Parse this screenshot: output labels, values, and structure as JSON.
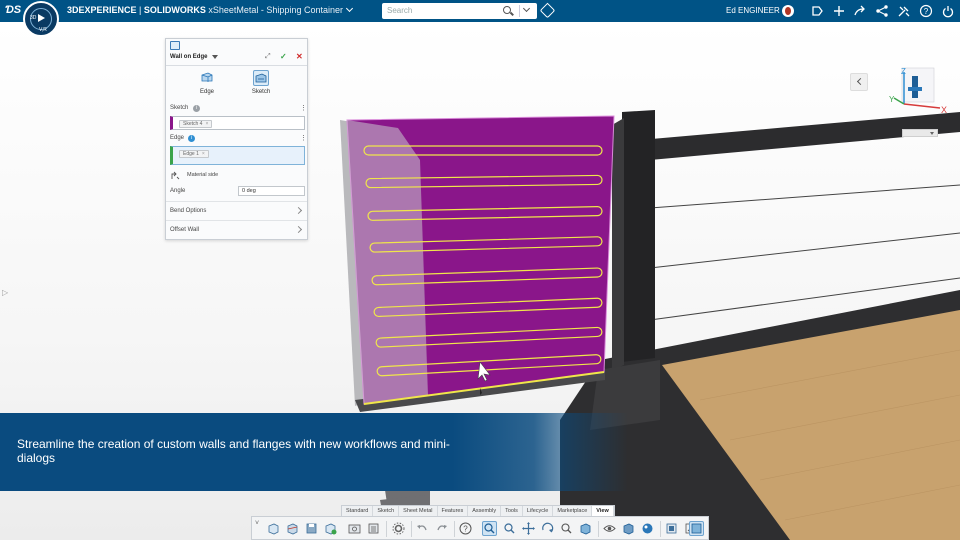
{
  "topbar": {
    "ds_logo": "ƊS",
    "compass_labels": {
      "top": "3D",
      "bottom": "V,R"
    },
    "brand_primary": "3DEXPERIENCE",
    "brand_separator": " | ",
    "brand_secondary": "SOLIDWORKS",
    "document_title": "xSheetMetal - Shipping Container",
    "search_placeholder": "Search",
    "user_name": "Ed ENGINEER",
    "icons": [
      "tag-icon",
      "avatar",
      "bookmark-icon",
      "plus-icon",
      "share-icon",
      "share-alt-icon",
      "tools-icon",
      "help-icon",
      "power-icon"
    ]
  },
  "property_manager": {
    "title": "Wall on Edge",
    "modes": [
      {
        "label": "Edge",
        "icon": "edge-mode-icon"
      },
      {
        "label": "Sketch",
        "icon": "sketch-mode-icon",
        "selected": true
      }
    ],
    "sketch_section": {
      "label": "Sketch",
      "chip": "Sketch 4"
    },
    "edge_section": {
      "label": "Edge",
      "chip": "Edge 1"
    },
    "material_side_label": "Material side",
    "angle": {
      "label": "Angle",
      "value": "0 deg"
    },
    "collapsed_sections": [
      "Bend Options",
      "Offset Wall"
    ]
  },
  "caption": {
    "text": "Streamline the creation of custom walls and flanges with new workflows and mini-dialogs"
  },
  "view_triad": {
    "axes": [
      "X",
      "Y",
      "Z"
    ]
  },
  "command_tabs": {
    "items": [
      "Standard",
      "Sketch",
      "Sheet Metal",
      "Features",
      "Assembly",
      "Tools",
      "Lifecycle",
      "Marketplace",
      "View"
    ],
    "active": "View"
  },
  "command_icons": [
    "view-orientation-icon",
    "section-view-icon",
    "save-icon",
    "rebuild-icon",
    "snapshot-icon",
    "appearance-icon",
    "options-icon",
    "undo-icon",
    "redo-icon",
    "help-icon",
    "zoom-fit-icon",
    "zoom-area-icon",
    "pan-icon",
    "rotate-icon",
    "zoom-icon",
    "3d-view-icon",
    "hide-show-icon",
    "display-style-icon",
    "edit-appearance-icon",
    "apply-scene-icon",
    "view-settings-icon",
    "shadows-icon",
    "realview-icon"
  ],
  "colors": {
    "topbar": "#005386",
    "wall_highlight": "#8a168a",
    "caption_bg": "#0a4b7f",
    "edge_highlight": "#f0e64a",
    "accept": "#3aa34a",
    "cancel": "#d02b2b"
  }
}
